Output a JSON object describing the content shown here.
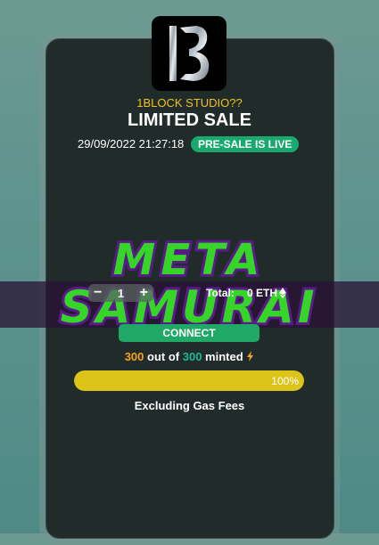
{
  "header": {
    "studio_name": "1BLOCK STUDIO??",
    "title": "LIMITED SALE",
    "date": "29/09/2022 21:27:18",
    "badge": "PRE-SALE IS LIVE",
    "logo_icon": "1b-logo-icon"
  },
  "banner": {
    "text": "META SAMURAI",
    "colors": {
      "fill": "#35d628",
      "outline": "#5a1a8a"
    }
  },
  "mint": {
    "quantity": "1",
    "minus_label": "−",
    "plus_label": "+",
    "total_label": "Total:",
    "total_value": "0 ETH",
    "eth_icon": "ethereum-icon",
    "connect_label": "CONNECT",
    "minted_count": "300",
    "minted_sep": " out of ",
    "minted_total": "300",
    "minted_suffix": " minted",
    "bolt_icon": "lightning-icon",
    "progress_percent": 100,
    "progress_label": "100%",
    "gas_note": "Excluding Gas Fees"
  },
  "colors": {
    "accent_green": "#1fa866",
    "gold": "#dcc418",
    "card_bg": "#202b2a"
  }
}
